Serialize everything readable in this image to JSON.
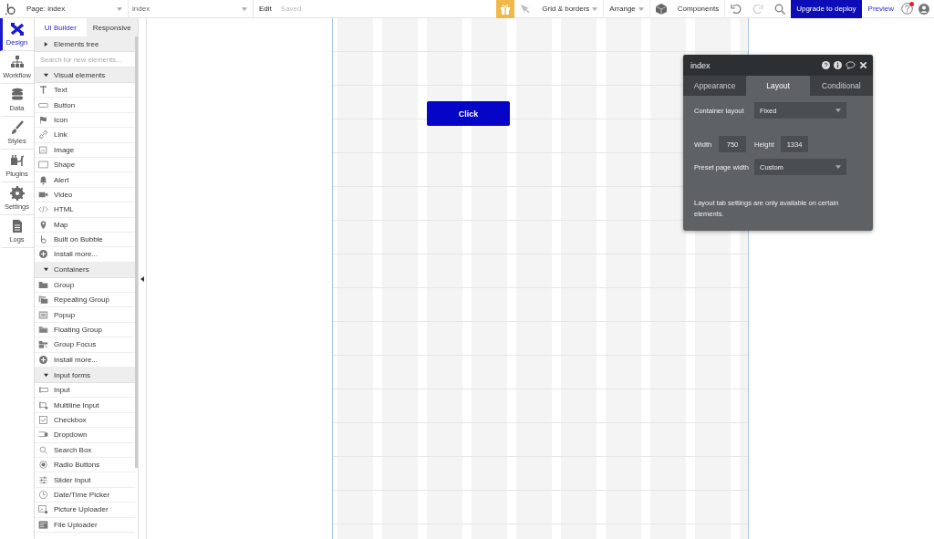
{
  "top_bar": {
    "page_selector": "Page: index",
    "element_selector": "index",
    "edit_menu": "Edit",
    "save_status": "Saved",
    "tools": [
      {
        "kind": "dropdown",
        "label": "Grid & borders"
      },
      {
        "kind": "dropdown",
        "label": "Arrange"
      },
      {
        "kind": "components",
        "label": "Components"
      }
    ],
    "upgrade_button": "Upgrade to deploy",
    "preview_link": "Preview"
  },
  "rail": [
    {
      "label": "Design",
      "selected": true
    },
    {
      "label": "Workflow",
      "selected": false
    },
    {
      "label": "Data",
      "selected": false
    },
    {
      "label": "Styles",
      "selected": false
    },
    {
      "label": "Plugins",
      "selected": false
    },
    {
      "label": "Settings",
      "selected": false
    },
    {
      "label": "Logs",
      "selected": false
    }
  ],
  "panel_tabs": [
    {
      "label": "UI Builder",
      "selected": true
    },
    {
      "label": "Responsive",
      "selected": false
    }
  ],
  "search": {
    "placeholder": "Search for new elements..."
  },
  "sections": [
    {
      "title": "Elements tree",
      "expanded": false
    },
    {
      "title": "Visual elements",
      "expanded": true,
      "items": [
        "Text",
        "Button",
        "Icon",
        "Link",
        "Image",
        "Shape",
        "Alert",
        "Video",
        "HTML",
        "Map",
        "Built on Bubble",
        "Install more..."
      ]
    },
    {
      "title": "Containers",
      "expanded": true,
      "items": [
        "Group",
        "Repeating Group",
        "Popup",
        "Floating Group",
        "Group Focus",
        "Install more..."
      ]
    },
    {
      "title": "Input forms",
      "expanded": true,
      "items": [
        "Input",
        "Multiline Input",
        "Checkbox",
        "Dropdown",
        "Search Box",
        "Radio Buttons",
        "Slider Input",
        "Date/Time Picker",
        "Picture Uploader",
        "File Uploader"
      ]
    }
  ],
  "canvas": {
    "button": "Click"
  },
  "property_editor": {
    "title": "index",
    "tabs": [
      {
        "label": "Appearance",
        "selected": false
      },
      {
        "label": "Layout",
        "selected": true
      },
      {
        "label": "Conditional",
        "selected": false
      }
    ],
    "container_layout": {
      "label": "Container layout",
      "value": "Fixed"
    },
    "width": {
      "label": "Width",
      "value": "750"
    },
    "height": {
      "label": "Height",
      "value": "1334"
    },
    "preset_width": {
      "label": "Preset page width",
      "value": "Custom"
    },
    "note": "Layout tab settings are only available on certain elements."
  }
}
